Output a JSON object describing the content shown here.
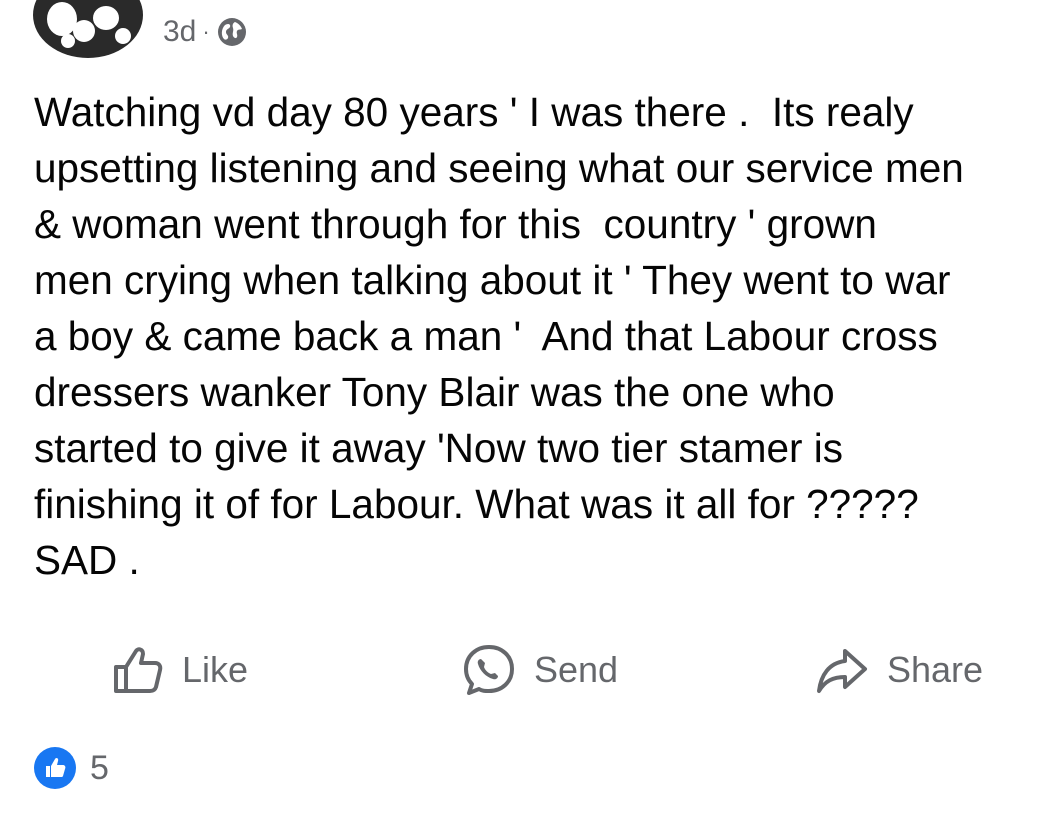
{
  "header": {
    "timestamp": "3d",
    "separator": "·",
    "audience_icon": "globe-icon"
  },
  "post": {
    "text": "Watching vd day 80 years ' I was there .  Its realy\nupsetting listening and seeing what our service men\n& woman went through for this  country ' grown\nmen crying when talking about it ' They went to war\na boy & came back a man '  And that Labour cross\ndressers wanker Tony Blair was the one who\nstarted to give it away 'Now two tier stamer is\nfinishing it of for Labour. What was it all for ?????\nSAD ."
  },
  "actions": {
    "like_label": "Like",
    "send_label": "Send",
    "share_label": "Share"
  },
  "reactions": {
    "icon": "like-icon",
    "count": "5"
  },
  "colors": {
    "text": "#050505",
    "secondary": "#65676b",
    "accent": "#1877f2"
  }
}
